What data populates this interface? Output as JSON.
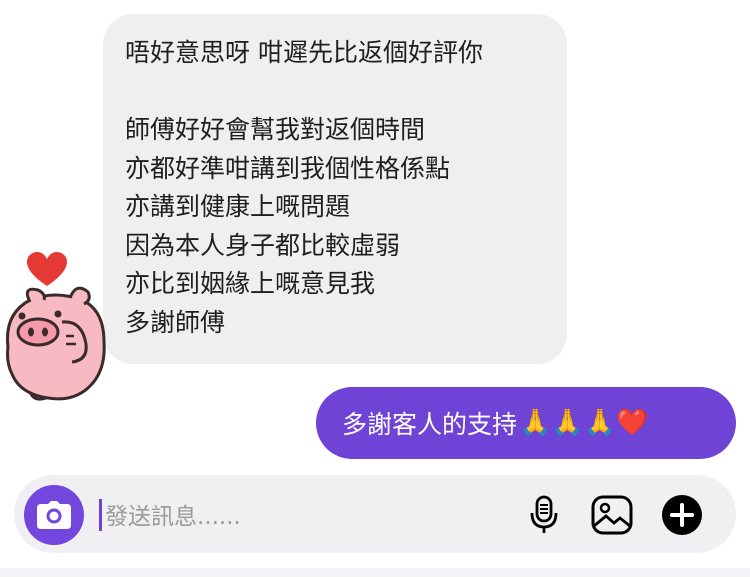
{
  "incoming_message": {
    "lines": [
      "唔好意思呀 咁遲先比返個好評你",
      "",
      "師傅好好會幫我對返個時間",
      "亦都好準咁講到我個性格係點",
      "亦講到健康上嘅問題",
      "因為本人身子都比較虛弱",
      "亦比到姻緣上嘅意見我",
      "多謝師傅"
    ],
    "reaction_icon": "red-heart",
    "avatar_icon": "pink-pig-sticker"
  },
  "outgoing_message": {
    "text": "多謝客人的支持",
    "emojis": "🙏🙏🙏❤️"
  },
  "composer": {
    "placeholder": "發送訊息......",
    "icons": [
      "camera-icon",
      "microphone-icon",
      "image-icon",
      "plus-icon"
    ]
  },
  "colors": {
    "accent": "#6e43d6",
    "incoming_bubble": "#efeff0",
    "heart": "#e53935"
  }
}
